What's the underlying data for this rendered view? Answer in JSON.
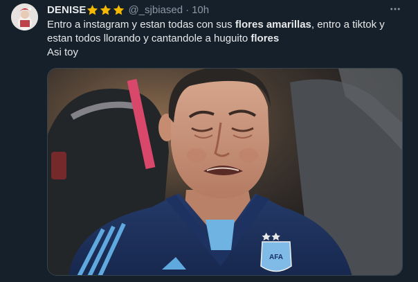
{
  "author": {
    "display_name": "DENISE",
    "handle": "@_sjbiased",
    "separator": "·",
    "timestamp": "10h",
    "badges": [
      "star-icon",
      "star-icon",
      "star-icon"
    ],
    "badge_color": "#f5b800"
  },
  "tweet": {
    "line1_a": "Entro a instagram y estan todas con sus ",
    "line1_bold": "flores amarillas",
    "line1_b": ", entro a tiktok y",
    "line2_a": "estan todos llorando y cantandole a huguito ",
    "line2_bold": "flores",
    "line3": "Asi toy"
  },
  "media": {
    "subject_icon": "crying-man-photo",
    "jersey_text": "AFA"
  },
  "colors": {
    "background": "#15202b",
    "text": "#e7e9ea",
    "secondary_text": "#8b98a5",
    "border": "#38444d"
  }
}
